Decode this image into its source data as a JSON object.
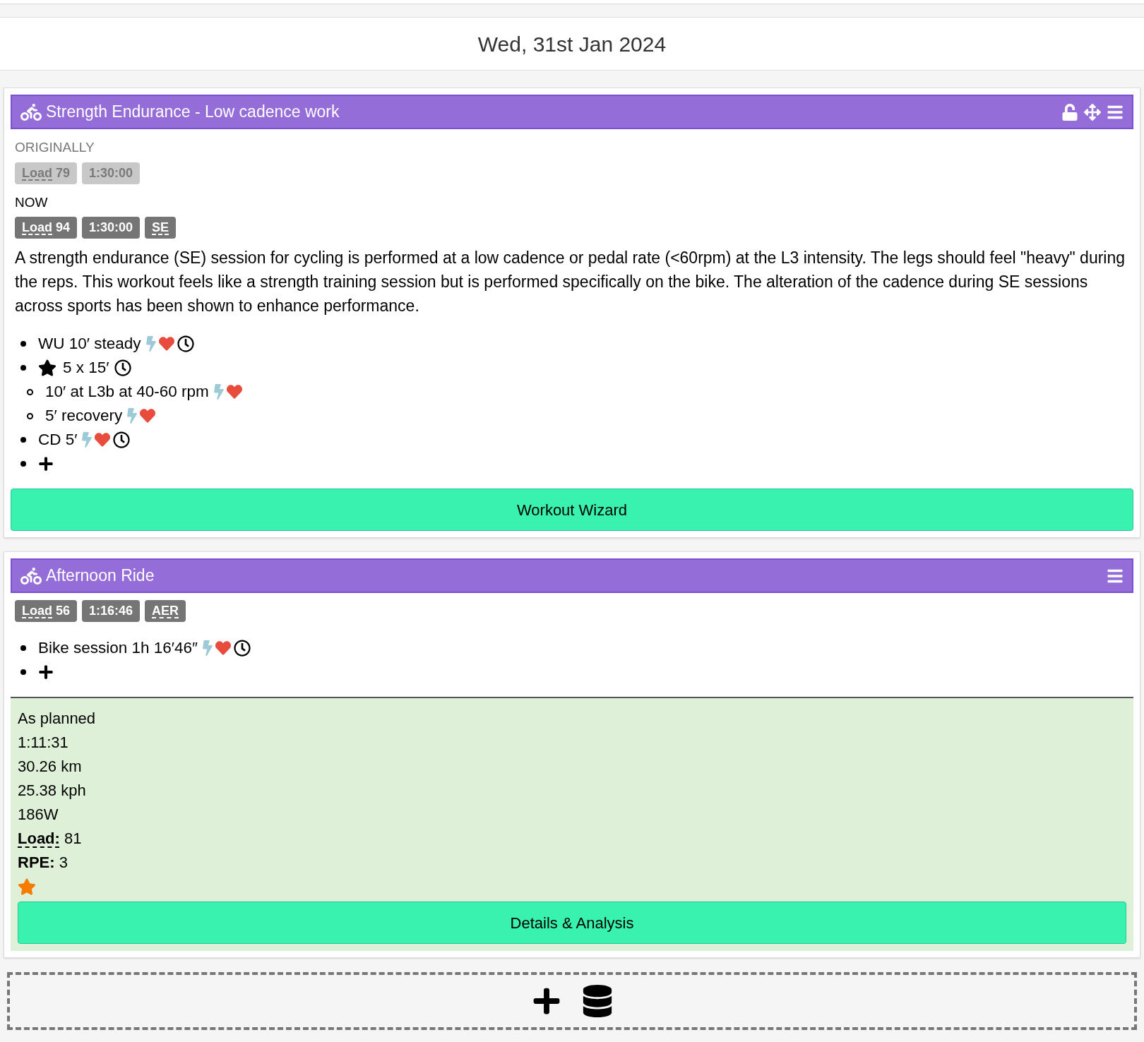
{
  "date": "Wed, 31st Jan 2024",
  "workouts": [
    {
      "title": "Strength Endurance - Low cadence work",
      "header_actions": [
        {
          "kind": "unlock"
        },
        {
          "kind": "move"
        },
        {
          "kind": "menu"
        }
      ],
      "sections": [
        {
          "label": "ORIGINALLY",
          "faded": true,
          "badges": [
            {
              "abbr": "Load",
              "value": "79"
            },
            {
              "value": "1:30:00"
            }
          ]
        },
        {
          "label": "NOW",
          "faded": false,
          "badges": [
            {
              "abbr": "Load",
              "value": "94"
            },
            {
              "value": "1:30:00"
            },
            {
              "abbr": "SE"
            }
          ]
        }
      ],
      "description": "A strength endurance (SE) session for cycling is performed at a low cadence or pedal rate (<60rpm) at the L3 intensity. The legs should feel \"heavy\" during the reps. This workout feels like a strength training session but is performed specifically on the bike. The alteration of the cadence during SE sessions across sports has been shown to enhance performance.",
      "steps": [
        {
          "text": "WU 10′ steady",
          "starred": false,
          "metrics": [
            {
              "kind": "power"
            },
            {
              "kind": "hr"
            },
            {
              "kind": "time"
            }
          ]
        },
        {
          "text": "5 x 15′",
          "starred": true,
          "metrics": [
            {
              "kind": "time"
            }
          ],
          "children": [
            {
              "text": "10′ at L3b at 40-60 rpm",
              "starred": false,
              "metrics": [
                {
                  "kind": "power"
                },
                {
                  "kind": "hr"
                }
              ]
            },
            {
              "text": "5′ recovery",
              "starred": false,
              "metrics": [
                {
                  "kind": "power"
                },
                {
                  "kind": "hr"
                }
              ]
            }
          ]
        },
        {
          "text": "CD 5′",
          "starred": false,
          "metrics": [
            {
              "kind": "power"
            },
            {
              "kind": "hr"
            },
            {
              "kind": "time"
            }
          ]
        }
      ],
      "button": "Workout Wizard"
    },
    {
      "title": "Afternoon Ride",
      "header_actions": [
        {
          "kind": "menu"
        }
      ],
      "sections": [
        {
          "faded": false,
          "badges": [
            {
              "abbr": "Load",
              "value": "56"
            },
            {
              "value": "1:16:46"
            },
            {
              "abbr": "AER"
            }
          ]
        }
      ],
      "steps": [
        {
          "text": "Bike session 1h 16′46″",
          "starred": false,
          "metrics": [
            {
              "kind": "power"
            },
            {
              "kind": "hr"
            },
            {
              "kind": "time"
            }
          ]
        }
      ],
      "result": {
        "lines": [
          "As planned",
          "1:11:31",
          "30.26 km",
          "25.38 kph",
          "186W"
        ],
        "fields": [
          {
            "label": "Load:",
            "value": "81",
            "abbr": true
          },
          {
            "label": "RPE:",
            "value": "3",
            "abbr": false
          }
        ],
        "starred": true,
        "button": "Details & Analysis"
      }
    }
  ]
}
